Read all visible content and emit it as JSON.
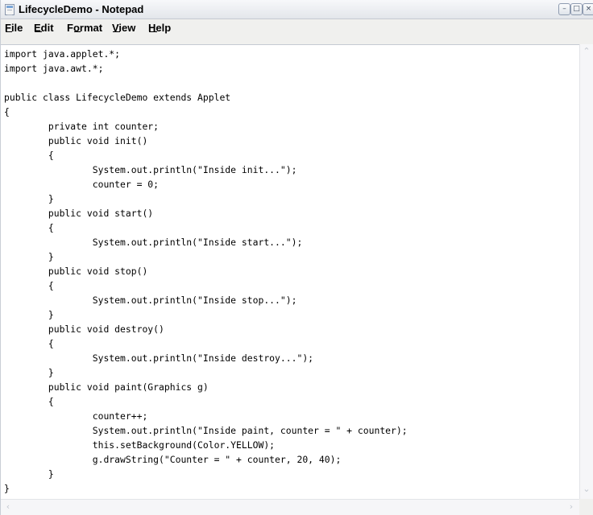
{
  "window": {
    "title": "LifecycleDemo - Notepad",
    "controls": {
      "minimize": "–",
      "maximize": "□",
      "close": "×"
    }
  },
  "menu": {
    "file": "File",
    "edit": "Edit",
    "format": "Format",
    "view": "View",
    "help": "Help"
  },
  "editor": {
    "lines": [
      "import java.applet.*;",
      "import java.awt.*;",
      "",
      "public class LifecycleDemo extends Applet",
      "{",
      "        private int counter;",
      "        public void init()",
      "        {",
      "                System.out.println(\"Inside init...\");",
      "                counter = 0;",
      "        }",
      "        public void start()",
      "        {",
      "                System.out.println(\"Inside start...\");",
      "        }",
      "        public void stop()",
      "        {",
      "                System.out.println(\"Inside stop...\");",
      "        }",
      "        public void destroy()",
      "        {",
      "                System.out.println(\"Inside destroy...\");",
      "        }",
      "        public void paint(Graphics g)",
      "        {",
      "                counter++;",
      "                System.out.println(\"Inside paint, counter = \" + counter);",
      "                this.setBackground(Color.YELLOW);",
      "                g.drawString(\"Counter = \" + counter, 20, 40);",
      "        }",
      "}"
    ]
  },
  "scrollbars": {
    "up_arrow": "⌃",
    "down_arrow": "⌄",
    "left_arrow": "‹",
    "right_arrow": "›"
  },
  "icons": {
    "app": "notepad-icon",
    "minimize": "minimize-icon",
    "maximize": "maximize-icon",
    "close": "close-icon"
  }
}
